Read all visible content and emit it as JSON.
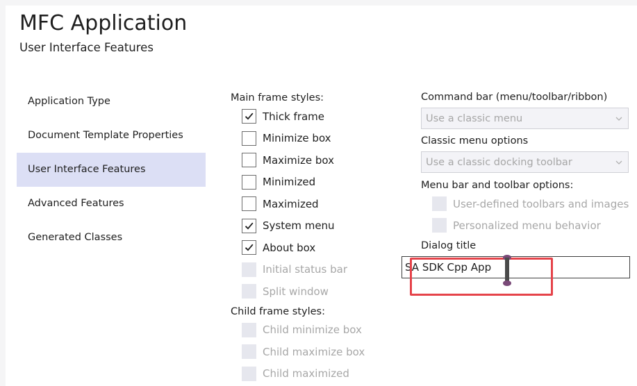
{
  "header": {
    "title": "MFC Application",
    "subtitle": "User Interface Features"
  },
  "sidebar": {
    "items": [
      {
        "label": "Application Type",
        "active": false
      },
      {
        "label": "Document Template Properties",
        "active": false
      },
      {
        "label": "User Interface Features",
        "active": true
      },
      {
        "label": "Advanced Features",
        "active": false
      },
      {
        "label": "Generated Classes",
        "active": false
      }
    ]
  },
  "main_frame": {
    "label": "Main frame styles:",
    "options": [
      {
        "label": "Thick frame",
        "checked": true,
        "disabled": false
      },
      {
        "label": "Minimize box",
        "checked": false,
        "disabled": false
      },
      {
        "label": "Maximize box",
        "checked": false,
        "disabled": false
      },
      {
        "label": "Minimized",
        "checked": false,
        "disabled": false
      },
      {
        "label": "Maximized",
        "checked": false,
        "disabled": false
      },
      {
        "label": "System menu",
        "checked": true,
        "disabled": false
      },
      {
        "label": "About box",
        "checked": true,
        "disabled": false
      },
      {
        "label": "Initial status bar",
        "checked": false,
        "disabled": true
      },
      {
        "label": "Split window",
        "checked": false,
        "disabled": true
      }
    ]
  },
  "child_frame": {
    "label": "Child frame styles:",
    "options": [
      {
        "label": "Child minimize box",
        "checked": false,
        "disabled": true
      },
      {
        "label": "Child maximize box",
        "checked": false,
        "disabled": true
      },
      {
        "label": "Child maximized",
        "checked": false,
        "disabled": true
      }
    ]
  },
  "right": {
    "command_bar_label": "Command bar (menu/toolbar/ribbon)",
    "command_bar_value": "Use a classic menu",
    "classic_menu_label": "Classic menu options",
    "classic_menu_value": "Use a classic docking toolbar",
    "menubar_options_label": "Menu bar and toolbar options:",
    "menubar_options": [
      {
        "label": "User-defined toolbars and images",
        "checked": false,
        "disabled": true
      },
      {
        "label": "Personalized menu behavior",
        "checked": false,
        "disabled": true
      }
    ],
    "dialog_title_label": "Dialog title",
    "dialog_title_value": "SA SDK Cpp App"
  },
  "colors": {
    "active_nav_bg": "#dcdff5",
    "highlight_border": "#e5434a",
    "disabled_text": "#a7a7a7"
  },
  "icons": {
    "check": "checkmark-icon",
    "dropdown": "chevron-down-icon",
    "cursor": "text-cursor-icon"
  }
}
